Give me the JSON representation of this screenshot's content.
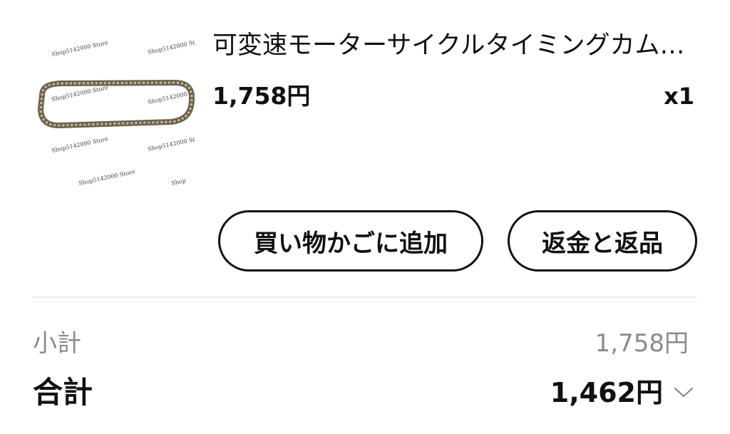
{
  "product": {
    "title": "可変速モーターサイクルタイミングカム…",
    "price": "1,758円",
    "quantity": "x1",
    "image_watermark": "Shop5142000 Store"
  },
  "actions": {
    "add_to_cart": "買い物かごに追加",
    "refund": "返金と返品"
  },
  "summary": {
    "subtotal_label": "小計",
    "subtotal_value": "1,758円",
    "total_label": "合計",
    "total_value": "1,462円",
    "expand_icon": "chevron-down-icon"
  }
}
